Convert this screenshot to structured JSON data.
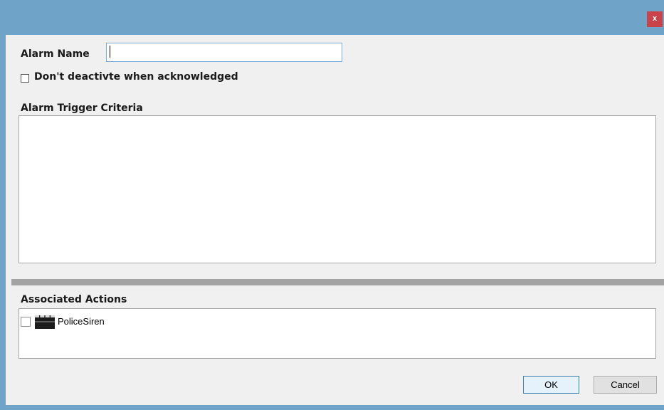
{
  "window": {
    "close_glyph": "x",
    "title_bar_color": "#6fa3c7",
    "close_button_color": "#c9444a"
  },
  "form": {
    "alarm_name_label": "Alarm Name",
    "alarm_name_value": "",
    "dont_deactivate_label": "Don't deactivte when acknowledged",
    "dont_deactivate_checked": false,
    "trigger_criteria_label": "Alarm Trigger Criteria"
  },
  "actions": {
    "section_label": "Associated Actions",
    "items": [
      {
        "label": "PoliceSiren",
        "checked": false,
        "icon": "clapperboard-icon"
      }
    ]
  },
  "buttons": {
    "ok_label": "OK",
    "cancel_label": "Cancel"
  }
}
